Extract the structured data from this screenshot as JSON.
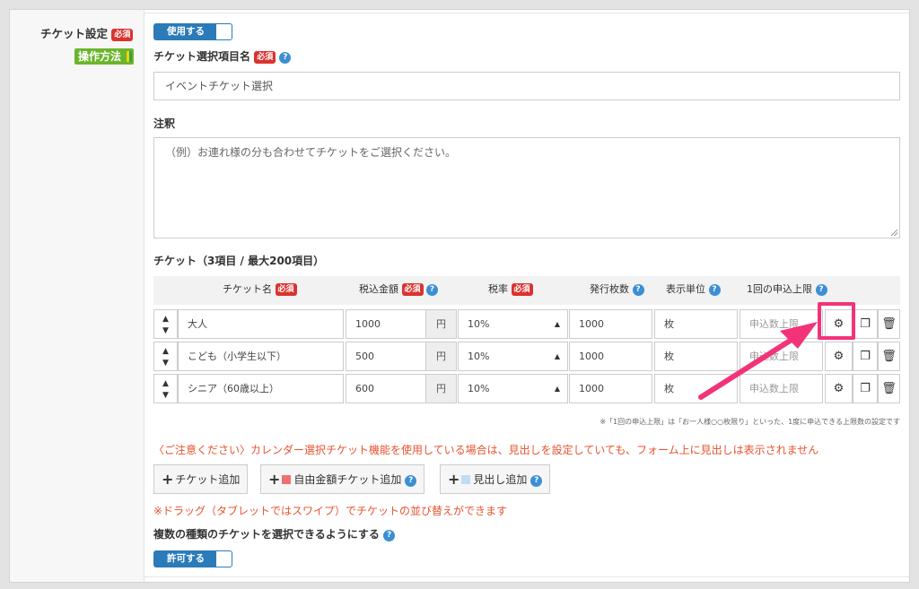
{
  "ticket_settings": {
    "title": "チケット設定",
    "required_badge": "必須",
    "howto_label": "操作方法",
    "use_toggle": "使用する"
  },
  "selection_name": {
    "label": "チケット選択項目名",
    "required_badge": "必須",
    "value": "イベントチケット選択"
  },
  "annotation": {
    "label": "注釈",
    "placeholder": "（例）お連れ様の分も合わせてチケットをご選択ください。"
  },
  "ticket_table": {
    "heading": "チケット（3項目 / 最大200項目）",
    "headers": {
      "name": "チケット名",
      "price": "税込金額",
      "tax": "税率",
      "issued": "発行枚数",
      "unit": "表示単位",
      "limit": "1回の申込上限"
    },
    "header_required": "必須",
    "currency": "円",
    "rows": [
      {
        "name": "大人",
        "price": "1000",
        "tax": "10%",
        "issued": "1000",
        "unit": "枚",
        "limit_placeholder": "申込数上限"
      },
      {
        "name": "こども（小学生以下）",
        "price": "500",
        "tax": "10%",
        "issued": "1000",
        "unit": "枚",
        "limit_placeholder": "申込数上限"
      },
      {
        "name": "シニア（60歳以上）",
        "price": "600",
        "tax": "10%",
        "issued": "1000",
        "unit": "枚",
        "limit_placeholder": "申込数上限"
      }
    ],
    "limit_note": "※「1回の申込上限」は「お一人様○○枚限り」といった、1度に申込できる上限数の設定です"
  },
  "calendar_warning": "〈ご注意ください〉カレンダー選択チケット機能を使用している場合は、見出しを設定していても、フォーム上に見出しは表示されません",
  "buttons": {
    "add_ticket": "チケット追加",
    "add_free_amount": "自由金額チケット追加",
    "add_heading": "見出し追加"
  },
  "drag_note": "※ドラッグ（タブレットではスワイプ）でチケットの並び替えができます",
  "multiple": {
    "label": "複数の種類のチケットを選択できるようにする",
    "toggle": "許可する"
  },
  "colors": {
    "accent_blue": "#2b7bb9",
    "required_red": "#d9332f",
    "warning_red": "#e8532f",
    "highlight_pink": "#f2337a",
    "howto_green": "#6bb52c"
  }
}
